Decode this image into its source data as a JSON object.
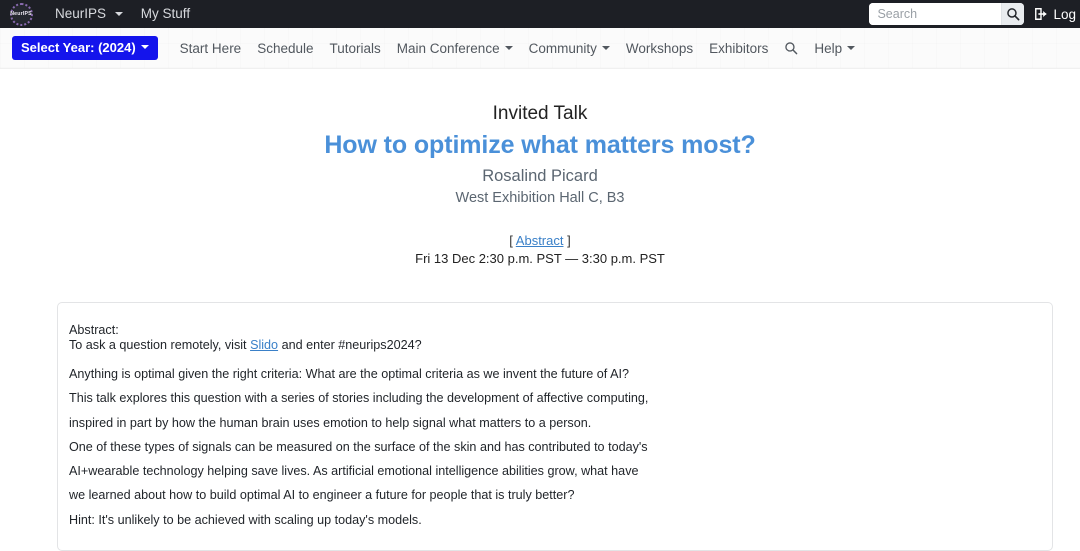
{
  "topbar": {
    "logo_alt": "NeurIPS",
    "logo_label": "NeurIPS",
    "items": [
      {
        "label": "NeurIPS",
        "has_caret": true
      },
      {
        "label": "My Stuff",
        "has_caret": false
      }
    ],
    "search": {
      "placeholder": "Search",
      "value": ""
    },
    "login_label": "Log"
  },
  "subnav": {
    "year_button": "Select Year: (2024)",
    "items": [
      {
        "label": "Start Here",
        "has_caret": false
      },
      {
        "label": "Schedule",
        "has_caret": false
      },
      {
        "label": "Tutorials",
        "has_caret": false
      },
      {
        "label": "Main Conference",
        "has_caret": true
      },
      {
        "label": "Community",
        "has_caret": true
      },
      {
        "label": "Workshops",
        "has_caret": false
      },
      {
        "label": "Exhibitors",
        "has_caret": false
      }
    ],
    "help": {
      "label": "Help",
      "has_caret": true
    }
  },
  "talk": {
    "kicker": "Invited Talk",
    "title": "How to optimize what matters most?",
    "speaker": "Rosalind Picard",
    "venue": "West Exhibition Hall C, B3",
    "abstract_bracket_open": "[",
    "abstract_link": "Abstract",
    "abstract_bracket_close": "]",
    "time": "Fri 13 Dec 2:30 p.m. PST — 3:30 p.m. PST"
  },
  "abstract": {
    "heading": "Abstract:",
    "slido_prefix": "To ask a question remotely, visit ",
    "slido_link": "Slido",
    "slido_suffix": " and enter #neurips2024?",
    "paragraphs": [
      "Anything is optimal given the right criteria: What are the optimal criteria as we invent the future of AI?",
      "This talk explores this question with a series of stories including the development of affective computing,",
      "inspired in part by how the human brain uses emotion to help signal what matters to a person.",
      "One of these types of signals can be measured on the surface of the skin and has contributed to today's",
      "AI+wearable technology helping save lives. As artificial emotional intelligence abilities grow, what have",
      "we learned about how to build optimal AI to engineer a future for people that is truly better?",
      "Hint: It's unlikely to be achieved with scaling up today's models."
    ]
  },
  "colors": {
    "topbar_bg": "#1d1f25",
    "title_blue": "#4a90d9",
    "year_button_blue": "#1414ec",
    "link_blue": "#3a80c8",
    "muted_text": "#5b6671"
  }
}
